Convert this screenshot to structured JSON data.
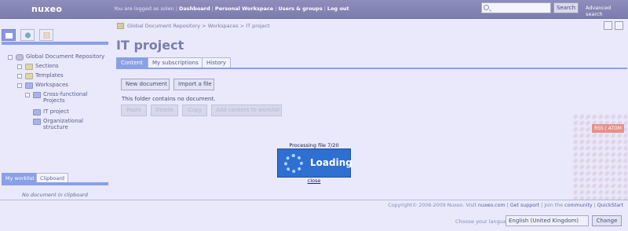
{
  "header": {
    "logo": "nuxeo",
    "logged_in_text": "You are logged as solen",
    "links": [
      "Dashboard",
      "Personal Workspace",
      "Users & groups",
      "Log out"
    ],
    "search_button": "Search",
    "advanced_search": "Advanced search"
  },
  "sidebar": {
    "tree": {
      "root": "Global Document Repository",
      "sections": "Sections",
      "templates": "Templates",
      "workspaces": "Workspaces",
      "cross_functional_line1": "Cross-functional",
      "cross_functional_line2": "Projects",
      "it_project": "IT project",
      "organizational_line1": "Organizational",
      "organizational_line2": "structure"
    },
    "worklist_tab": "My worklist",
    "clipboard_tab": "Clipboard",
    "clipboard_empty": "No document in clipboard"
  },
  "breadcrumb": {
    "items": [
      "Global Document Repository",
      "Workspaces",
      "IT project"
    ],
    "sep": " > "
  },
  "main": {
    "title": "IT project",
    "tabs": [
      "Content",
      "My subscriptions",
      "History"
    ],
    "new_document": "New document",
    "import_file": "Import a file",
    "no_document": "This folder contains no document.",
    "disabled_actions": [
      "Paste",
      "Delete",
      "Copy",
      "Add content to worklist"
    ],
    "rss_label": "RSS | ATOM"
  },
  "loading": {
    "processing": "Processing file 7/20",
    "label": "Loading",
    "close": "close"
  },
  "footer": {
    "copyright_prefix": "Copyright© 2006-2009 Nuxeo. Visit",
    "site": "nuxeo.com",
    "get_support": "Get support",
    "join_prefix": "Join the",
    "community": "community",
    "quickstart": "QuickStart",
    "choose_language": "Choose your language:",
    "language_value": "English (United Kingdom)",
    "change": "Change"
  },
  "colors": {
    "accent": "#8aa0e6",
    "header": "#7c7cad",
    "loading": "#2f6fd0"
  }
}
